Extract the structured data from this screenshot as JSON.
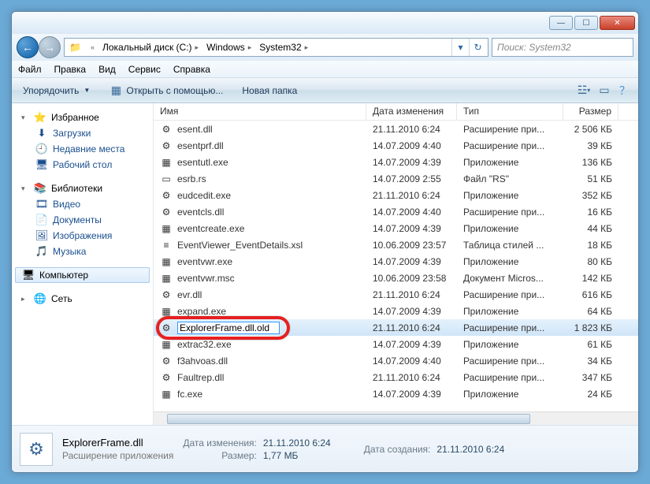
{
  "titlebar": {
    "minimize": "—",
    "maximize": "☐",
    "close": "✕"
  },
  "nav": {
    "back": "←",
    "forward": "→"
  },
  "breadcrumb": [
    "Локальный диск (C:)",
    "Windows",
    "System32"
  ],
  "search": {
    "placeholder": "Поиск: System32"
  },
  "menu": [
    "Файл",
    "Правка",
    "Вид",
    "Сервис",
    "Справка"
  ],
  "toolbar": {
    "organize": "Упорядочить",
    "openWith": "Открыть с помощью...",
    "newFolder": "Новая папка"
  },
  "sidebar": {
    "fav": {
      "label": "Избранное",
      "items": [
        "Загрузки",
        "Недавние места",
        "Рабочий стол"
      ],
      "icons": [
        "⬇",
        "🕘",
        "🖥"
      ]
    },
    "lib": {
      "label": "Библиотеки",
      "items": [
        "Видео",
        "Документы",
        "Изображения",
        "Музыка"
      ],
      "icons": [
        "🎞",
        "📄",
        "🖼",
        "🎵"
      ]
    },
    "comp": {
      "label": "Компьютер"
    },
    "net": {
      "label": "Сеть"
    }
  },
  "columns": {
    "name": "Имя",
    "date": "Дата изменения",
    "type": "Тип",
    "size": "Размер"
  },
  "files": [
    {
      "icon": "⚙",
      "name": "esent.dll",
      "date": "21.11.2010 6:24",
      "type": "Расширение при...",
      "size": "2 506 КБ"
    },
    {
      "icon": "⚙",
      "name": "esentprf.dll",
      "date": "14.07.2009 4:40",
      "type": "Расширение при...",
      "size": "39 КБ"
    },
    {
      "icon": "▦",
      "name": "esentutl.exe",
      "date": "14.07.2009 4:39",
      "type": "Приложение",
      "size": "136 КБ"
    },
    {
      "icon": "▭",
      "name": "esrb.rs",
      "date": "14.07.2009 2:55",
      "type": "Файл \"RS\"",
      "size": "51 КБ"
    },
    {
      "icon": "⚙",
      "name": "eudcedit.exe",
      "date": "21.11.2010 6:24",
      "type": "Приложение",
      "size": "352 КБ"
    },
    {
      "icon": "⚙",
      "name": "eventcls.dll",
      "date": "14.07.2009 4:40",
      "type": "Расширение при...",
      "size": "16 КБ"
    },
    {
      "icon": "▦",
      "name": "eventcreate.exe",
      "date": "14.07.2009 4:39",
      "type": "Приложение",
      "size": "44 КБ"
    },
    {
      "icon": "≡",
      "name": "EventViewer_EventDetails.xsl",
      "date": "10.06.2009 23:57",
      "type": "Таблица стилей ...",
      "size": "18 КБ"
    },
    {
      "icon": "▦",
      "name": "eventvwr.exe",
      "date": "14.07.2009 4:39",
      "type": "Приложение",
      "size": "80 КБ"
    },
    {
      "icon": "▦",
      "name": "eventvwr.msc",
      "date": "10.06.2009 23:58",
      "type": "Документ Micros...",
      "size": "142 КБ"
    },
    {
      "icon": "⚙",
      "name": "evr.dll",
      "date": "21.11.2010 6:24",
      "type": "Расширение при...",
      "size": "616 КБ"
    },
    {
      "icon": "▦",
      "name": "expand.exe",
      "date": "14.07.2009 4:39",
      "type": "Приложение",
      "size": "64 КБ"
    },
    {
      "icon": "⚙",
      "name": "ExplorerFrame.dll.old",
      "date": "21.11.2010 6:24",
      "type": "Расширение при...",
      "size": "1 823 КБ",
      "sel": true,
      "edit": true
    },
    {
      "icon": "▦",
      "name": "extrac32.exe",
      "date": "14.07.2009 4:39",
      "type": "Приложение",
      "size": "61 КБ"
    },
    {
      "icon": "⚙",
      "name": "f3ahvoas.dll",
      "date": "14.07.2009 4:40",
      "type": "Расширение при...",
      "size": "34 КБ"
    },
    {
      "icon": "⚙",
      "name": "Faultrep.dll",
      "date": "21.11.2010 6:24",
      "type": "Расширение при...",
      "size": "347 КБ"
    },
    {
      "icon": "▦",
      "name": "fc.exe",
      "date": "14.07.2009 4:39",
      "type": "Приложение",
      "size": "24 КБ"
    }
  ],
  "details": {
    "name": "ExplorerFrame.dll",
    "type": "Расширение приложения",
    "modLabel": "Дата изменения:",
    "modVal": "21.11.2010 6:24",
    "sizeLabel": "Размер:",
    "sizeVal": "1,77 МБ",
    "createLabel": "Дата создания:",
    "createVal": "21.11.2010 6:24"
  }
}
